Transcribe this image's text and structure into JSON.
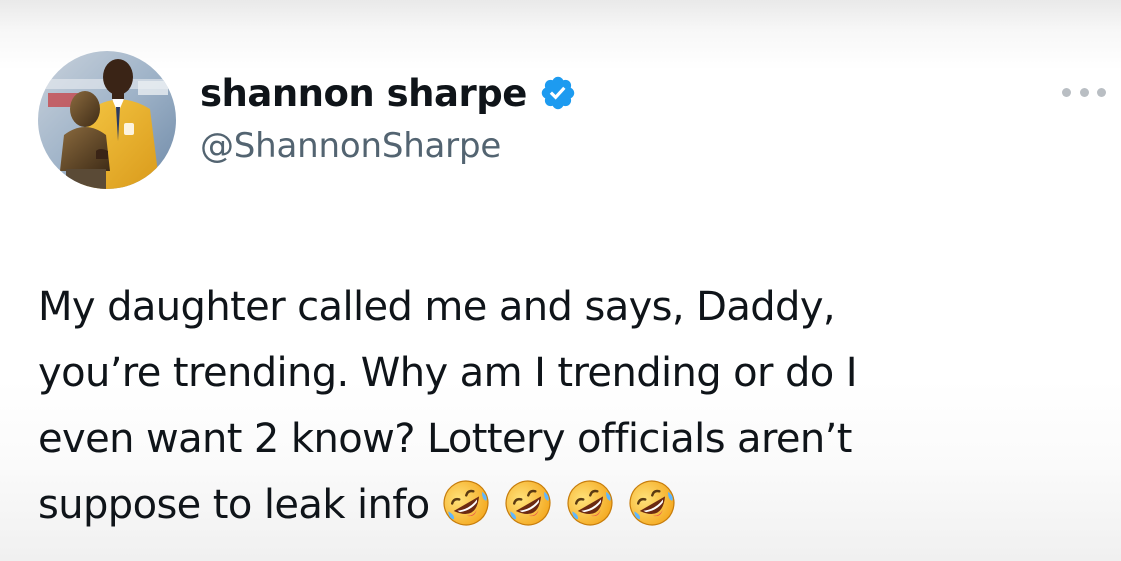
{
  "author": {
    "display_name": "shannon sharpe",
    "handle": "@ShannonSharpe",
    "verified": true,
    "verified_color": "#1d9bf0"
  },
  "tweet": {
    "lines": [
      "My daughter called me and says, Daddy,",
      "you’re trending. Why am I trending or do I",
      "even want 2 know?  Lottery officials aren’t",
      "suppose to leak info"
    ],
    "emojis": [
      "🤣",
      "🤣",
      "🤣",
      "🤣"
    ]
  },
  "icons": {
    "verified": "verified-badge-icon",
    "more": "more-options-icon",
    "emoji": "rolling-on-floor-laughing-emoji"
  }
}
